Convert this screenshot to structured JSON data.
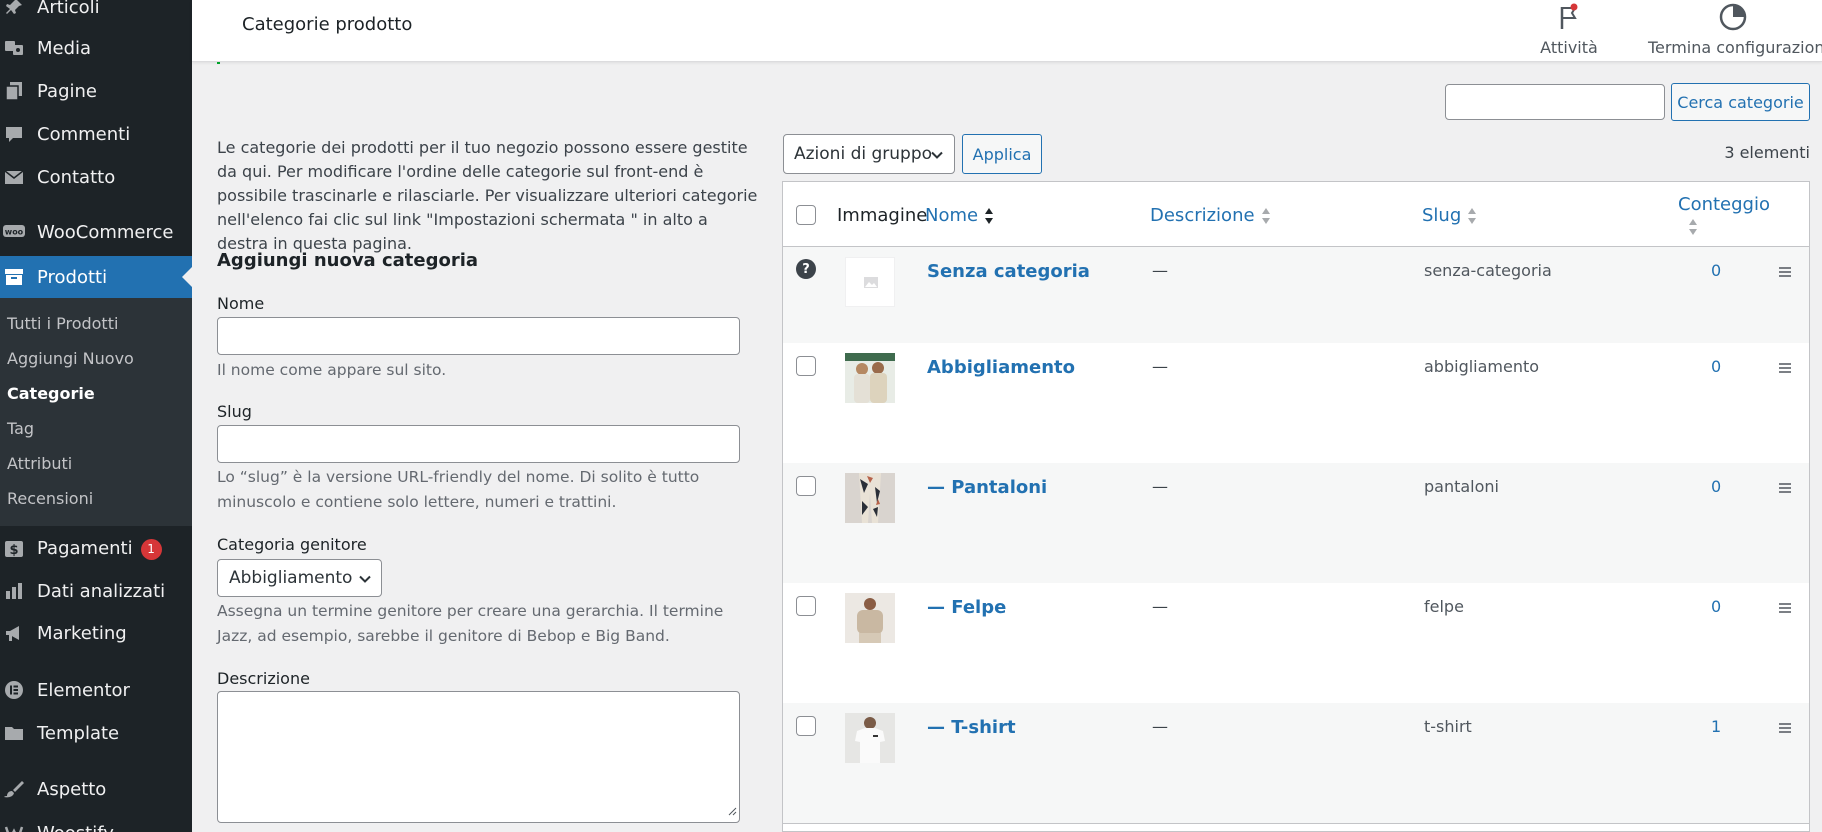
{
  "sidebar": {
    "items": [
      {
        "label": "Articoli",
        "icon": "pin-icon"
      },
      {
        "label": "Media",
        "icon": "media-icon"
      },
      {
        "label": "Pagine",
        "icon": "page-icon"
      },
      {
        "label": "Commenti",
        "icon": "comment-icon"
      },
      {
        "label": "Contatto",
        "icon": "mail-icon"
      },
      {
        "label": "WooCommerce",
        "icon": "woo-icon"
      },
      {
        "label": "Prodotti",
        "icon": "archive-icon"
      },
      {
        "label": "Pagamenti",
        "icon": "dollar-icon",
        "badge": "1"
      },
      {
        "label": "Dati analizzati",
        "icon": "bar-chart-icon"
      },
      {
        "label": "Marketing",
        "icon": "megaphone-icon"
      },
      {
        "label": "Elementor",
        "icon": "elementor-icon"
      },
      {
        "label": "Template",
        "icon": "folder-icon"
      },
      {
        "label": "Aspetto",
        "icon": "brush-icon"
      },
      {
        "label": "Woostify",
        "icon": "woostify-icon"
      }
    ],
    "submenu": [
      "Tutti i Prodotti",
      "Aggiungi Nuovo",
      "Categorie",
      "Tag",
      "Attributi",
      "Recensioni"
    ]
  },
  "header": {
    "title": "Categorie prodotto",
    "activity_label": "Attività",
    "setup_label": "Termina configurazione"
  },
  "search": {
    "button_label": "Cerca categorie",
    "value": ""
  },
  "intro": {
    "text": "Le categorie dei prodotti per il tuo negozio possono essere gestite da qui. Per modificare l'ordine delle categorie sul front-end è possibile trascinarle e rilasciarle. Per visualizzare ulteriori categorie nell'elenco fai clic sul link \"Impostazioni schermata \" in alto a destra in questa pagina."
  },
  "form": {
    "heading": "Aggiungi nuova categoria",
    "name_label": "Nome",
    "name_help": "Il nome come appare sul sito.",
    "slug_label": "Slug",
    "slug_help": "Lo “slug” è la versione URL-friendly del nome. Di solito è tutto minuscolo e contiene solo lettere, numeri e trattini.",
    "parent_label": "Categoria genitore",
    "parent_value": "Abbigliamento",
    "parent_help": "Assegna un termine genitore per creare una gerarchia. Il termine Jazz, ad esempio, sarebbe il genitore di Bebop e Big Band.",
    "desc_label": "Descrizione"
  },
  "toolbar": {
    "bulk_label": "Azioni di gruppo",
    "apply_label": "Applica",
    "items_count": "3 elementi"
  },
  "table": {
    "columns": {
      "image": "Immagine",
      "name": "Nome",
      "description": "Descrizione",
      "slug": "Slug",
      "count": "Conteggio"
    },
    "rows": [
      {
        "name": "Senza categoria",
        "description": "—",
        "slug": "senza-categoria",
        "count": "0"
      },
      {
        "name": "Abbigliamento",
        "description": "—",
        "slug": "abbigliamento",
        "count": "0"
      },
      {
        "name": "— Pantaloni",
        "description": "—",
        "slug": "pantaloni",
        "count": "0"
      },
      {
        "name": "— Felpe",
        "description": "—",
        "slug": "felpe",
        "count": "0"
      },
      {
        "name": "— T-shirt",
        "description": "—",
        "slug": "t-shirt",
        "count": "1"
      }
    ]
  },
  "colors": {
    "accent": "#2271b1",
    "sidebar": "#1d2327",
    "badge": "#d63638"
  }
}
